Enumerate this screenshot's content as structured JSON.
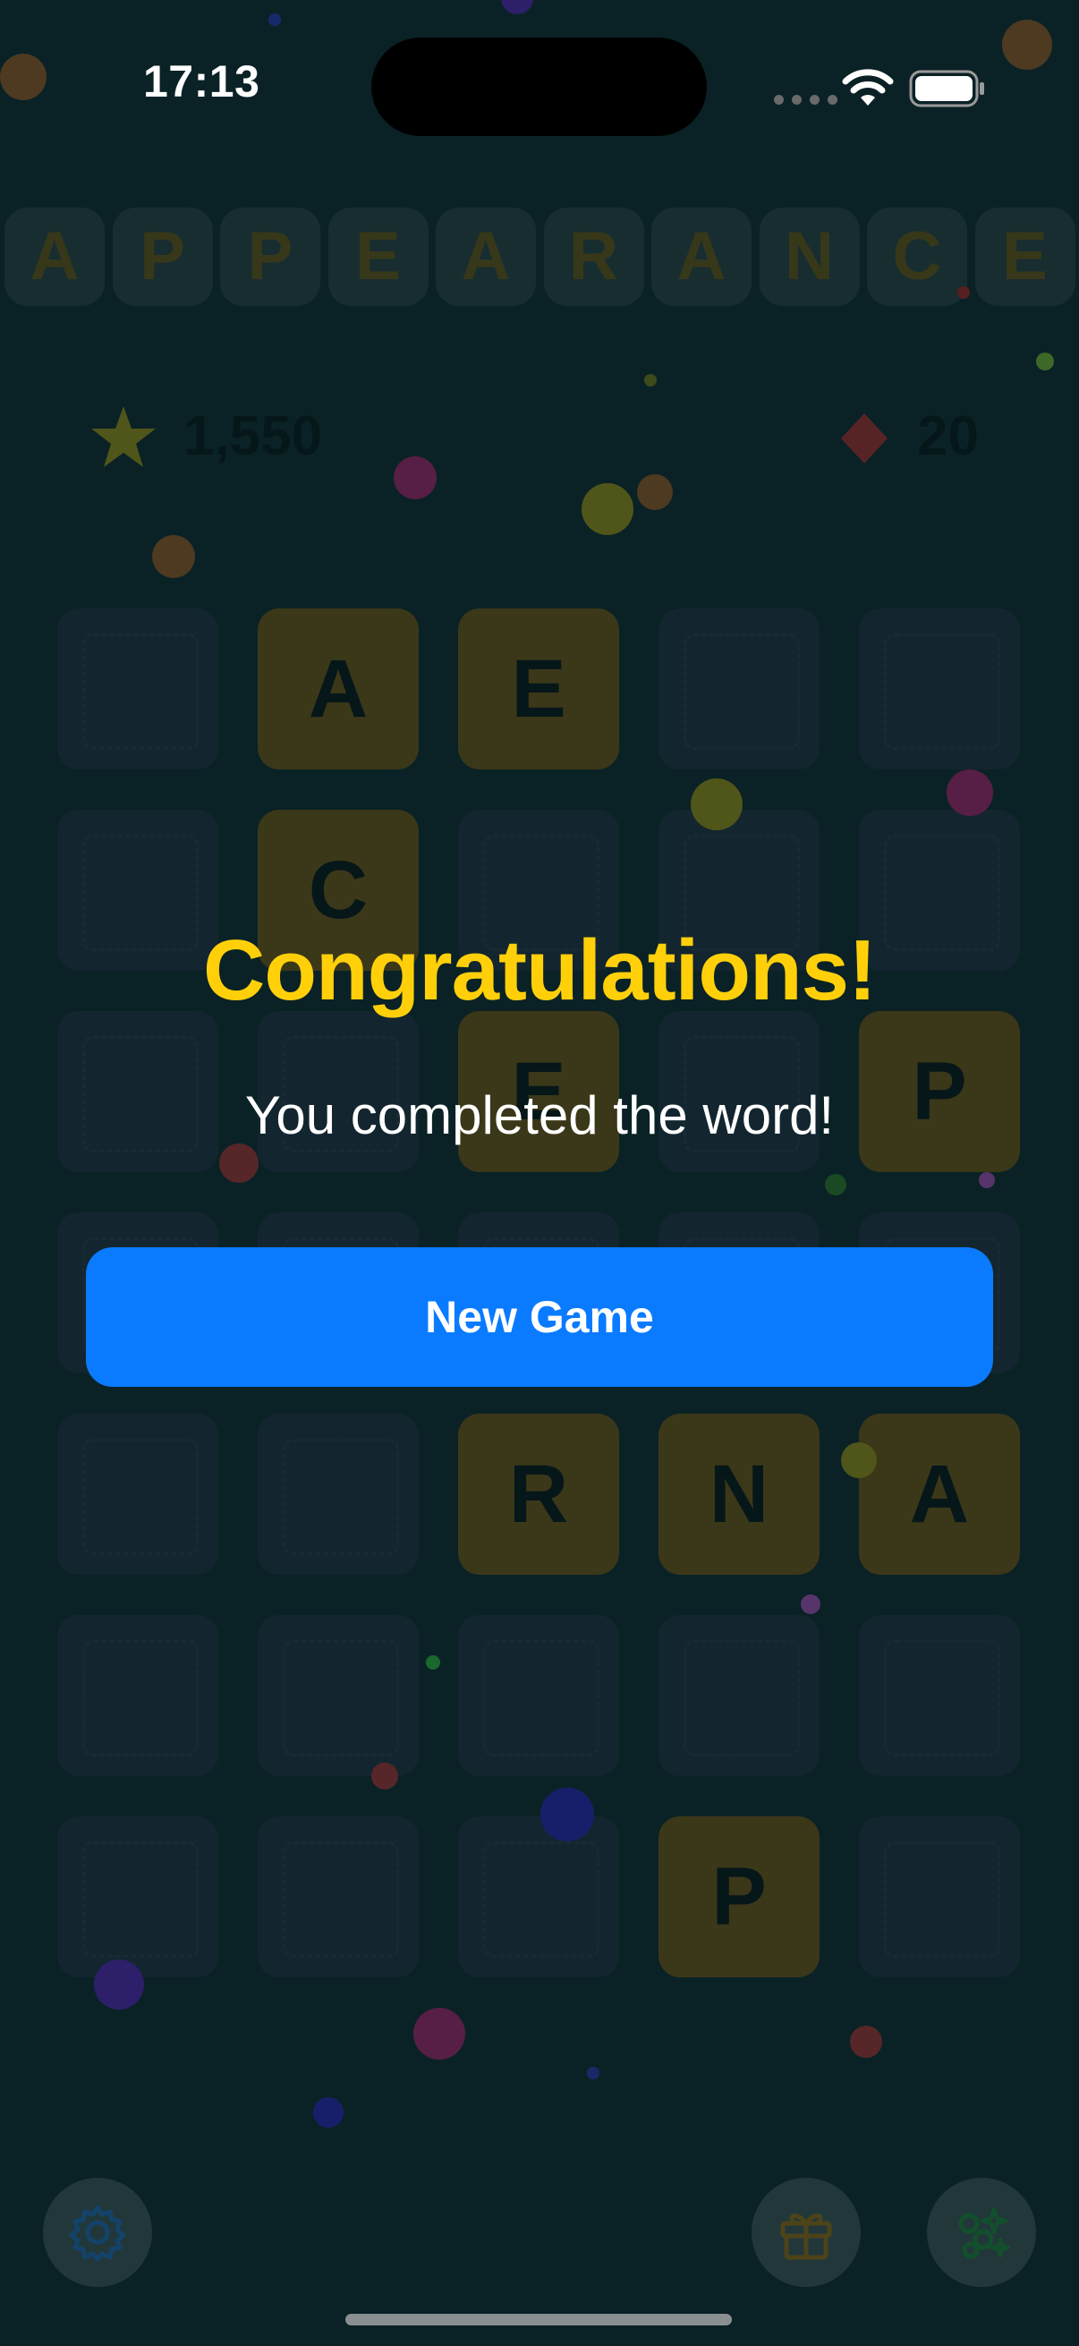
{
  "status_bar": {
    "time": "17:13"
  },
  "word": [
    "A",
    "P",
    "P",
    "E",
    "A",
    "R",
    "A",
    "N",
    "C",
    "E"
  ],
  "scores": {
    "points": "1,550",
    "gems": "20"
  },
  "grid": [
    [
      "",
      "A",
      "E",
      "",
      ""
    ],
    [
      "",
      "C",
      "",
      "",
      ""
    ],
    [
      "",
      "",
      "E",
      "",
      "P"
    ],
    [
      "",
      "",
      "",
      "",
      ""
    ],
    [
      "",
      "",
      "R",
      "N",
      "A"
    ],
    [
      "",
      "",
      "",
      "",
      ""
    ],
    [
      "",
      "",
      "",
      "P",
      ""
    ]
  ],
  "dialog": {
    "title": "Congratulations!",
    "message": "You completed the word!",
    "button_label": "New Game"
  },
  "bottom_bar": {
    "left_icon": "gear-icon",
    "right_icons": [
      "gift-icon",
      "sparkles-icon"
    ]
  },
  "colors": {
    "title": "#ffd00a",
    "button": "#0a7bff",
    "tile_filled": "#a86400"
  }
}
